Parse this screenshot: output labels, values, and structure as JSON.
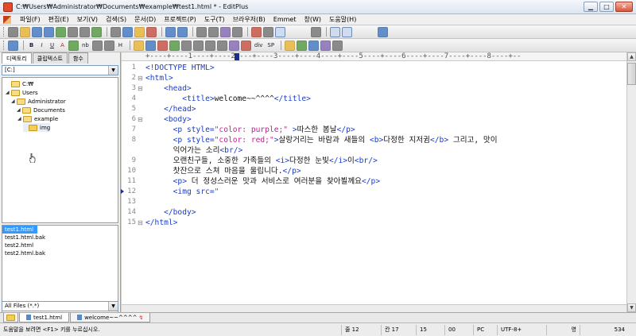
{
  "window": {
    "title": "C:₩Users₩Administrator₩Documents₩example₩test1.html * - EditPlus",
    "min_label": "▁",
    "max_label": "□",
    "close_label": "✕"
  },
  "menu": [
    "파일(F)",
    "편집(E)",
    "보기(V)",
    "검색(S)",
    "문서(D)",
    "프로젝트(P)",
    "도구(T)",
    "브라우저(B)",
    "Emmet",
    "창(W)",
    "도움말(H)"
  ],
  "toolbar2_text": [
    "B",
    "I",
    "U",
    "A",
    "nb",
    "H"
  ],
  "toolbar2_text_b": [
    "div",
    "SP"
  ],
  "sidebar": {
    "tabs": [
      "디렉토리",
      "클립텍스트",
      "함수"
    ],
    "drive": "[C:]",
    "tree": [
      {
        "label": "C:₩",
        "depth": 0
      },
      {
        "label": "Users",
        "depth": 1
      },
      {
        "label": "Administrator",
        "depth": 2
      },
      {
        "label": "Documents",
        "depth": 3
      },
      {
        "label": "example",
        "depth": 4
      },
      {
        "label": "img",
        "depth": 5
      }
    ],
    "files": [
      "test1.html",
      "test1.html.bak",
      "test2.html",
      "test2.html.bak"
    ],
    "filter": "All Files (*.*)"
  },
  "editor": {
    "ruler": "+----+----1----+----2----+----3----+----4----+----5----+----6----+----7----+----8----+--",
    "lines": [
      {
        "n": "1",
        "html": "<span class='tag'>&lt;!DOCTYPE HTML&gt;</span>"
      },
      {
        "n": "2",
        "html": "<span class='tag'>&lt;html&gt;</span>",
        "fold": "⊟"
      },
      {
        "n": "3",
        "html": "    <span class='tag'>&lt;head&gt;</span>",
        "fold": "⊟"
      },
      {
        "n": "4",
        "html": "        <span class='tag'>&lt;title&gt;</span><span class='txt'>welcome~~^^^^</span><span class='tag'>&lt;/title&gt;</span>"
      },
      {
        "n": "5",
        "html": "    <span class='tag'>&lt;/head&gt;</span>"
      },
      {
        "n": "6",
        "html": "    <span class='tag'>&lt;body&gt;</span>",
        "fold": "⊟"
      },
      {
        "n": "7",
        "html": "      <span class='tag'>&lt;p </span><span class='attr'>style=</span><span class='str'>\"color: purple;\"</span><span class='tag'> &gt;</span><span class='txt'>따스한 봄날</span><span class='tag'>&lt;/p&gt;</span>"
      },
      {
        "n": "8",
        "html": "      <span class='tag'>&lt;p </span><span class='attr'>style=</span><span class='str'>\"color: red;\"</span><span class='tag'>&gt;</span><span class='txt'>살랑거리는 바람과 새들의 </span><span class='tag'>&lt;b&gt;</span><span class='txt'>다정한 지저귐</span><span class='tag'>&lt;/b&gt;</span><span class='txt'> 그리고, 맛이</span>"
      },
      {
        "n": "",
        "html": "      <span class='txt'>익어가는 소리</span><span class='tag'>&lt;br/&gt;</span>"
      },
      {
        "n": "9",
        "html": "      <span class='txt'>오랜친구들, 소중한 가족들의 </span><span class='tag'>&lt;i&gt;</span><span class='txt'>다정한 눈빛</span><span class='tag'>&lt;/i&gt;</span><span class='txt'>이</span><span class='tag'>&lt;br/&gt;</span>"
      },
      {
        "n": "10",
        "html": "      <span class='txt'>찻잔으로 스쳐 마음을 울립니다.</span><span class='tag'>&lt;/p&gt;</span>"
      },
      {
        "n": "11",
        "html": "      <span class='tag'>&lt;p&gt;</span><span class='txt'> 더 정성스러운 맛과 서비스로 여러분을 찾아뵐께요</span><span class='tag'>&lt;/p&gt;</span>"
      },
      {
        "n": "12",
        "html": "      <span class='tag'>&lt;img </span><span class='attr'>src=</span><span class='str'>\"</span>",
        "bookmark": true
      },
      {
        "n": "13",
        "html": ""
      },
      {
        "n": "14",
        "html": "    <span class='tag'>&lt;/body&gt;</span>"
      },
      {
        "n": "15",
        "html": "<span class='tag'>&lt;/html&gt;</span>",
        "fold": "⊟"
      }
    ]
  },
  "doc_tabs": [
    {
      "label": "test1.html",
      "active": true,
      "modified": false
    },
    {
      "label": "welcome~~^^^^",
      "active": false,
      "modified": true
    }
  ],
  "modified_mark": "↯",
  "status": {
    "help": "도움말을 보려면 <F1> 키를 누르십시오.",
    "line": "줄 12",
    "col": "칸 17",
    "c3": "15",
    "c4": "00",
    "c5": "PC",
    "encoding": "UTF-8+",
    "c7": "영",
    "size": "534"
  }
}
